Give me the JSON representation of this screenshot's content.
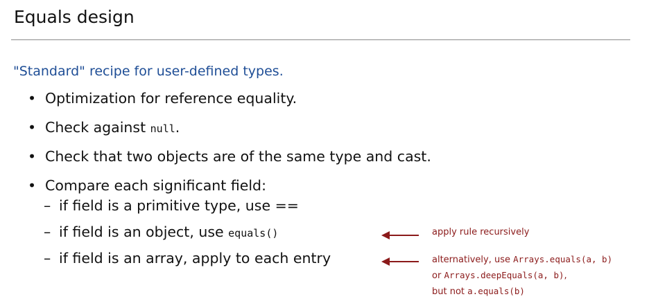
{
  "slide": {
    "title": "Equals design",
    "subtitle": "\"Standard\" recipe for user-defined types.",
    "bullets": [
      {
        "marker": "•",
        "text": "Optimization for reference equality."
      },
      {
        "marker": "•",
        "text_before": "Check against ",
        "code": "null",
        "text_after": "."
      },
      {
        "marker": "•",
        "text": "Check that two objects are of the same type and cast."
      },
      {
        "marker": "•",
        "text": "Compare each significant field:"
      }
    ],
    "subitems": [
      {
        "marker": "–",
        "text": "if field is a primitive type, use =="
      },
      {
        "marker": "–",
        "text_before": "if field is an object, use ",
        "code": "equals()"
      },
      {
        "marker": "–",
        "text": "if field is an array, apply to each entry"
      }
    ],
    "annotations": {
      "object_note": "apply rule recursively",
      "array_note_line1_text": "alternatively, use ",
      "array_note_line1_code": "Arrays.equals(a, b)",
      "array_note_line2_text": "or ",
      "array_note_line2_code": "Arrays.deepEquals(a, b)",
      "array_note_line2_after": ",",
      "array_note_line3_text": "but not ",
      "array_note_line3_code": "a.equals(b)"
    },
    "colors": {
      "subtitle": "#1f4e96",
      "annotation": "#8b1a1a",
      "rule": "#8a8a8a"
    }
  }
}
